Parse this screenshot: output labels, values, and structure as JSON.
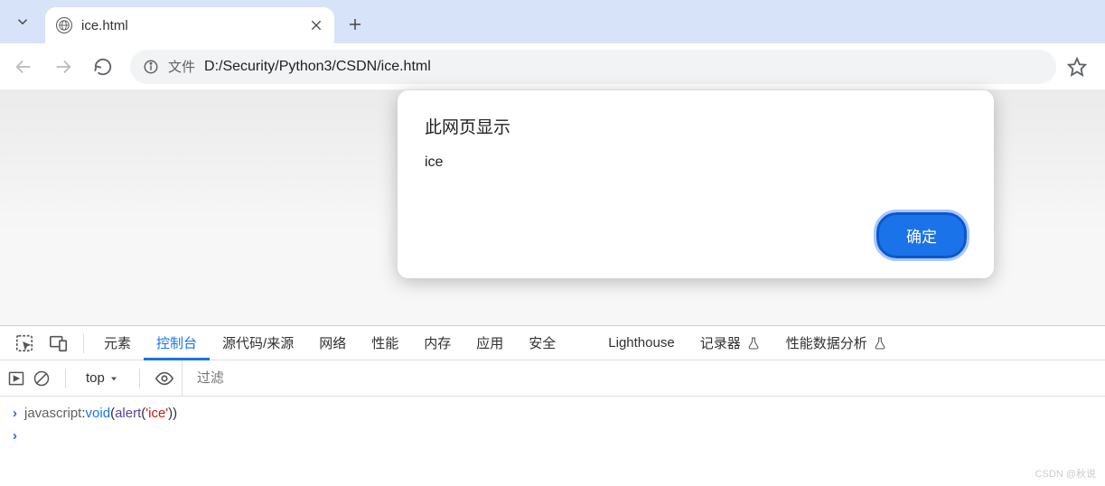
{
  "tab": {
    "title": "ice.html"
  },
  "address": {
    "file_label": "文件",
    "url": "D:/Security/Python3/CSDN/ice.html"
  },
  "dialog": {
    "title": "此网页显示",
    "message": "ice",
    "ok": "确定"
  },
  "devtools": {
    "tabs": [
      "元素",
      "控制台",
      "源代码/来源",
      "网络",
      "性能",
      "内存",
      "应用",
      "安全",
      "Lighthouse",
      "记录器",
      "性能数据分析"
    ],
    "active_index": 1,
    "context": "top",
    "filter_placeholder": "过滤",
    "console_input": {
      "protocol": "javascript",
      "colon": ":",
      "kw": "void",
      "lp1": "(",
      "fn": "alert",
      "lp2": "(",
      "str": "'ice'",
      "rp1": ")",
      "rp2": ")"
    }
  },
  "watermark": "CSDN @秋说"
}
